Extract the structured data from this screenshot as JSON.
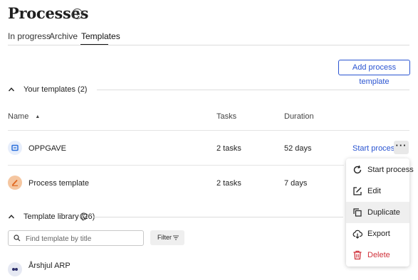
{
  "page": {
    "title": "Processes"
  },
  "tabs": [
    {
      "label": "In progress"
    },
    {
      "label": "Archive"
    },
    {
      "label": "Templates"
    }
  ],
  "actions": {
    "add_template_label": "Add process template"
  },
  "your_templates": {
    "title": "Your templates (2)",
    "columns": {
      "name": "Name",
      "tasks": "Tasks",
      "duration": "Duration"
    },
    "rows": [
      {
        "name": "OPPGAVE",
        "tasks": "2 tasks",
        "duration": "52 days",
        "action": "Start process",
        "icon": "document-icon",
        "icon_color": "#2a6fdb"
      },
      {
        "name": "Process template",
        "tasks": "2 tasks",
        "duration": "7 days",
        "icon": "pencil-icon",
        "icon_color": "#f2c29a"
      }
    ]
  },
  "context_menu": {
    "items": [
      {
        "label": "Start process",
        "icon": "restart-icon"
      },
      {
        "label": "Edit",
        "icon": "edit-icon"
      },
      {
        "label": "Duplicate",
        "icon": "duplicate-icon"
      },
      {
        "label": "Export",
        "icon": "export-icon"
      },
      {
        "label": "Delete",
        "icon": "trash-icon",
        "color": "#d0313a"
      }
    ]
  },
  "template_library": {
    "title": "Template library (26)",
    "search_placeholder": "Find template by title",
    "filter_label": "Filter",
    "items": [
      {
        "name": "Årshjul ARP"
      }
    ]
  },
  "colors": {
    "accent": "#2a54d1",
    "danger": "#d0313a"
  }
}
